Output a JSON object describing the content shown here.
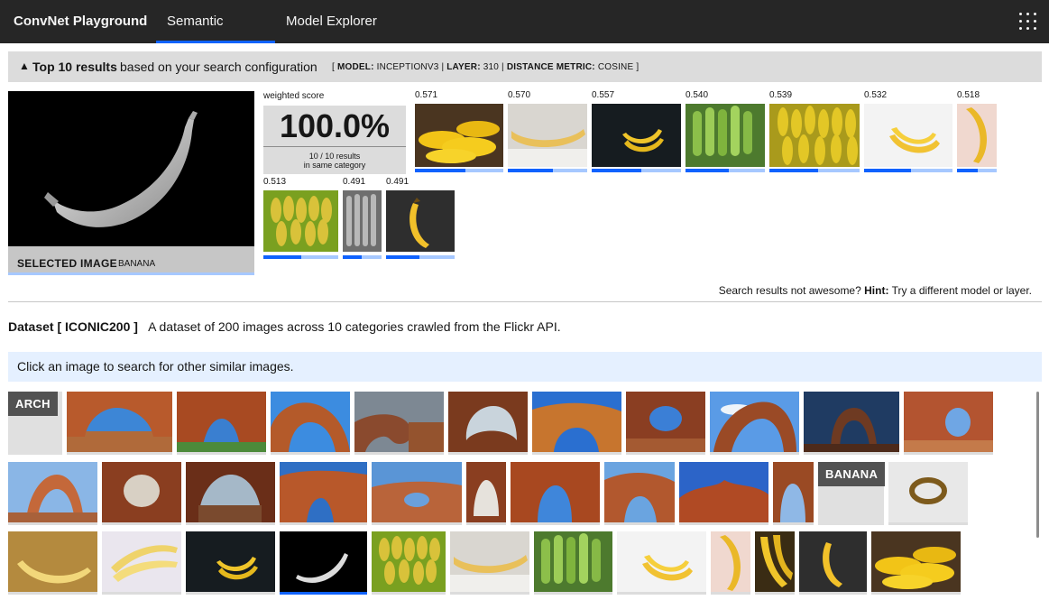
{
  "app": {
    "brand": "ConvNet Playground",
    "tabs": [
      {
        "label": "Semantic Search",
        "active": true
      },
      {
        "label": "Model Explorer",
        "active": false
      }
    ],
    "menu_icon": "grid-icon"
  },
  "results": {
    "caret": "▲",
    "title": "Top 10 results",
    "description": "based on your search configuration",
    "config": {
      "model_key": "MODEL:",
      "model_val": "INCEPTIONV3",
      "layer_key": "LAYER:",
      "layer_val": "310",
      "metric_key": "DISTANCE METRIC:",
      "metric_val": "COSINE"
    },
    "selected_label": "SELECTED IMAGE",
    "selected_category": "BANANA",
    "weighted_label": "weighted score",
    "weighted_value": "100.0%",
    "weighted_sub1": "10 / 10 results",
    "weighted_sub2": "in same category",
    "items": [
      {
        "score": "0.571",
        "fraction": 0.57
      },
      {
        "score": "0.570",
        "fraction": 0.57
      },
      {
        "score": "0.557",
        "fraction": 0.56
      },
      {
        "score": "0.540",
        "fraction": 0.54
      },
      {
        "score": "0.539",
        "fraction": 0.54
      },
      {
        "score": "0.532",
        "fraction": 0.53
      },
      {
        "score": "0.518",
        "fraction": 0.52
      },
      {
        "score": "0.513",
        "fraction": 0.51
      },
      {
        "score": "0.491",
        "fraction": 0.49
      },
      {
        "score": "0.491",
        "fraction": 0.49
      }
    ],
    "hint_prefix": "Search results not awesome?",
    "hint_key": "Hint:",
    "hint_text": "Try a different model or layer."
  },
  "dataset": {
    "name": "Dataset [ ICONIC200 ]",
    "description": "A dataset of 200 images across 10 categories crawled from the Flickr API.",
    "click_hint": "Click an image to search for other similar images.",
    "categories": [
      "ARCH",
      "BANANA"
    ]
  },
  "colors": {
    "topbar": "#262626",
    "accent": "#0f62fe",
    "accent_light": "#a6c8ff"
  }
}
